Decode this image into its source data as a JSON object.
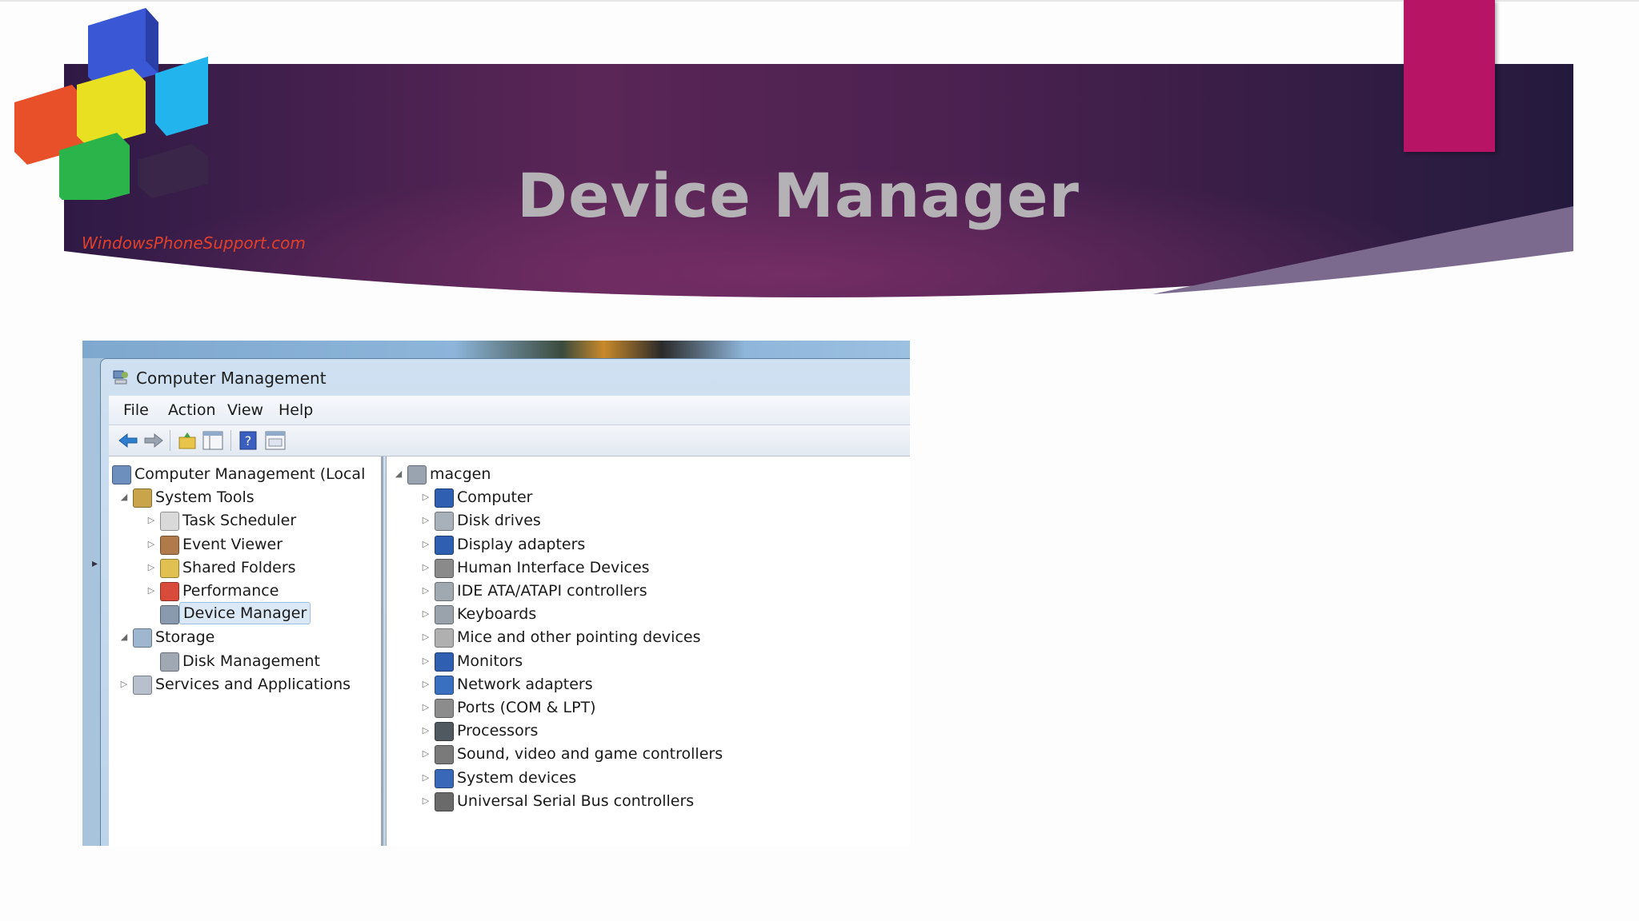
{
  "slide": {
    "title": "Device Manager",
    "logo_text": "WindowsPhoneSupport.com",
    "colors": {
      "banner_dark": "#2b1b3e",
      "banner_mid": "#5e2a5e",
      "accent": "#b81466",
      "title": "#b4b2b4"
    }
  },
  "window": {
    "title": "Computer Management",
    "menu": [
      "File",
      "Action",
      "View",
      "Help"
    ],
    "toolbar": [
      "back-icon",
      "forward-icon",
      "up-icon",
      "show-hide-tree-icon",
      "help-icon",
      "properties-icon"
    ]
  },
  "left_tree": [
    {
      "label": "Computer Management (Local",
      "icon": "computer-management-icon",
      "expand": ""
    },
    {
      "label": "System Tools",
      "icon": "tools-icon",
      "expand": "◢"
    },
    {
      "label": "Task Scheduler",
      "icon": "clock-icon",
      "expand": "▷"
    },
    {
      "label": "Event Viewer",
      "icon": "event-viewer-icon",
      "expand": "▷"
    },
    {
      "label": "Shared Folders",
      "icon": "shared-folder-icon",
      "expand": "▷"
    },
    {
      "label": "Performance",
      "icon": "performance-icon",
      "expand": "▷"
    },
    {
      "label": "Device Manager",
      "icon": "device-manager-icon",
      "expand": "",
      "selected": true
    },
    {
      "label": "Storage",
      "icon": "storage-icon",
      "expand": "◢"
    },
    {
      "label": "Disk Management",
      "icon": "disk-management-icon",
      "expand": ""
    },
    {
      "label": "Services and Applications",
      "icon": "services-icon",
      "expand": "▷"
    }
  ],
  "right_tree": [
    {
      "label": "macgen",
      "icon": "computer-icon",
      "expand": "◢"
    },
    {
      "label": "Computer",
      "icon": "monitor-icon",
      "expand": "▷"
    },
    {
      "label": "Disk drives",
      "icon": "disk-drive-icon",
      "expand": "▷"
    },
    {
      "label": "Display adapters",
      "icon": "display-adapter-icon",
      "expand": "▷"
    },
    {
      "label": "Human Interface Devices",
      "icon": "hid-icon",
      "expand": "▷"
    },
    {
      "label": "IDE ATA/ATAPI controllers",
      "icon": "ide-controller-icon",
      "expand": "▷"
    },
    {
      "label": "Keyboards",
      "icon": "keyboard-icon",
      "expand": "▷"
    },
    {
      "label": "Mice and other pointing devices",
      "icon": "mouse-icon",
      "expand": "▷"
    },
    {
      "label": "Monitors",
      "icon": "monitor-icon",
      "expand": "▷"
    },
    {
      "label": "Network adapters",
      "icon": "network-adapter-icon",
      "expand": "▷"
    },
    {
      "label": "Ports (COM & LPT)",
      "icon": "port-icon",
      "expand": "▷"
    },
    {
      "label": "Processors",
      "icon": "processor-icon",
      "expand": "▷"
    },
    {
      "label": "Sound, video and game controllers",
      "icon": "speaker-icon",
      "expand": "▷"
    },
    {
      "label": "System devices",
      "icon": "system-device-icon",
      "expand": "▷"
    },
    {
      "label": "Universal Serial Bus controllers",
      "icon": "usb-icon",
      "expand": "▷"
    }
  ]
}
